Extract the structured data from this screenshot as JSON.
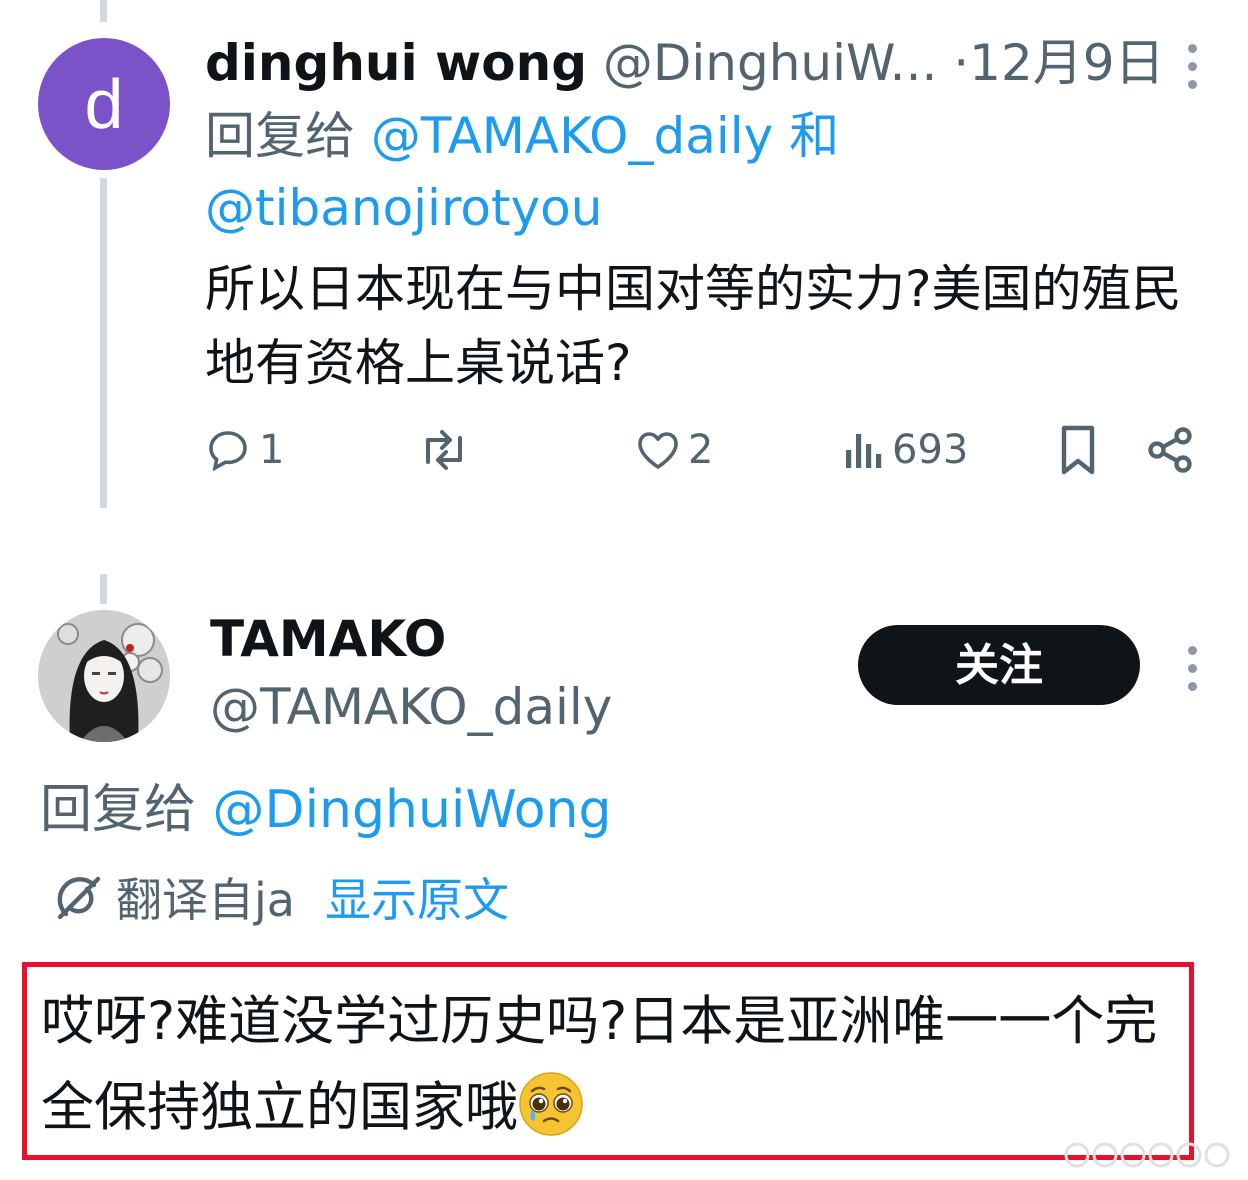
{
  "tweet1": {
    "avatar_letter": "d",
    "display_name": "dinghui wong",
    "handle": "@DinghuiW...",
    "date": "·12月9日",
    "reply_prefix": "回复给",
    "reply_to_1": "@TAMAKO_daily",
    "reply_joiner": "和",
    "reply_to_2": "@tibanojirotyou",
    "text": "所以日本现在与中国对等的实力?美国的殖民地有资格上桌说话?",
    "actions": {
      "reply_icon": "reply-icon",
      "reply_count": "1",
      "retweet_icon": "retweet-icon",
      "like_icon": "heart-icon",
      "like_count": "2",
      "views_icon": "views-icon",
      "views_count": "693",
      "bookmark_icon": "bookmark-icon",
      "share_icon": "share-icon"
    }
  },
  "tweet2": {
    "display_name": "TAMAKO",
    "handle": "@TAMAKO_daily",
    "follow_label": "关注",
    "reply_prefix": "回复给",
    "reply_to": "@DinghuiWong",
    "translated_from": "翻译自ja",
    "show_original": "显示原文",
    "text": "哎呀?难道没学过历史吗?日本是亚洲唯一一个完全保持独立的国家哦",
    "emoji": "pleading-face-emoji"
  },
  "colors": {
    "text": "#0f1419",
    "muted": "#536471",
    "link": "#1d9bf0",
    "highlight_border": "#e8112d",
    "avatar_d": "#7c52c9",
    "follow_button": "#0f1419"
  }
}
